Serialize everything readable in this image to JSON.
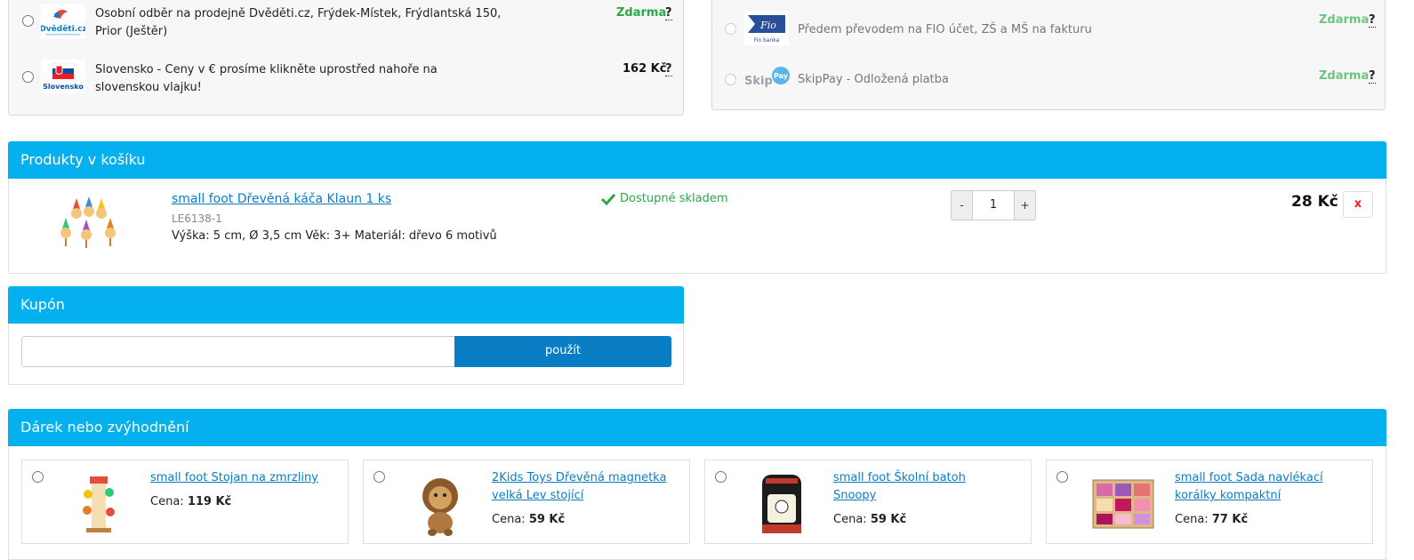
{
  "shipping": {
    "options": [
      {
        "text": "Osobní odběr na prodejně Dvěděti.cz, Frýdek-Místek, Frýdlantská 150, Prior (Ještěr)",
        "price": "Zdarma",
        "help": "?",
        "logo": "Dvěděti.cz"
      },
      {
        "text": "Slovensko - Ceny v € prosíme klikněte uprostřed nahoře na slovenskou vlajku!",
        "price": "162 Kč",
        "help": "?",
        "logo": "Slovensko"
      }
    ]
  },
  "payment": {
    "options": [
      {
        "text": "Předem převodem na FIO účet, ZŠ a MŠ na fakturu",
        "price": "Zdarma",
        "help": "?",
        "logo_top": "Fio",
        "logo_bottom": "Fio banka"
      },
      {
        "text": "SkipPay - Odložená platba",
        "price": "Zdarma",
        "help": "?",
        "logo_a": "Skip",
        "logo_b": "Pay"
      }
    ]
  },
  "cart": {
    "title": "Produkty v košíku",
    "item": {
      "name": "small foot Dřevěná káča Klaun 1 ks",
      "code": "LE6138-1",
      "desc": "Výška: 5 cm, Ø 3,5 cm Věk: 3+ Materiál: dřevo 6 motivů",
      "stock": "Dostupné skladem",
      "qty": "1",
      "minus": "-",
      "plus": "+",
      "price": "28 Kč",
      "remove": "x"
    }
  },
  "coupon": {
    "title": "Kupón",
    "placeholder": "",
    "button": "použít"
  },
  "gifts": {
    "title": "Dárek nebo zvýhodnění",
    "price_label": "Cena:",
    "items": [
      {
        "name": "small foot Stojan na zmrzliny",
        "price": "119 Kč"
      },
      {
        "name": "2Kids Toys Dřevěná magnetka velká Lev stojící",
        "price": "59 Kč"
      },
      {
        "name": "small foot Školní batoh Snoopy",
        "price": "59 Kč"
      },
      {
        "name": "small foot Sada navlékací korálky kompaktní",
        "price": "77 Kč"
      }
    ]
  },
  "colors": {
    "header_blue": "#05b0ee",
    "button_blue": "#0a7ec4",
    "free_green": "#2aa84a",
    "remove_red": "#e02424"
  }
}
